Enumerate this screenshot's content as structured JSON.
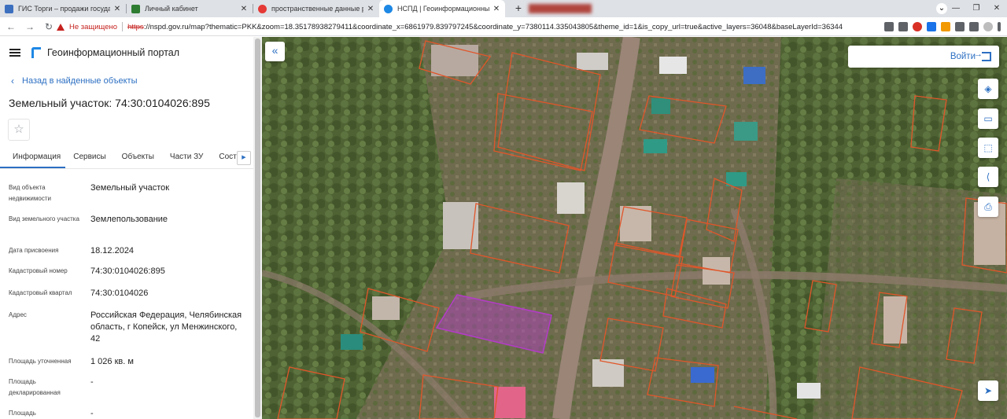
{
  "browser": {
    "tabs": [
      {
        "title": "ГИС Торги – продажи государств",
        "favicon_color": "#3d6fbf"
      },
      {
        "title": "Личный кабинет",
        "favicon_color": "#2e7d32"
      },
      {
        "title": "пространственные данные рос",
        "favicon_color": "#e53935"
      },
      {
        "title": "НСПД | Геоинформационный п",
        "favicon_color": "#1e88e5"
      }
    ],
    "new_tab_icon": "+",
    "address": {
      "security_label": "Не защищено",
      "url_scheme": "https",
      "url_rest": "://nspd.gov.ru/map?thematic=PKK&zoom=18.35178938279411&coordinate_x=6861979.839797245&coordinate_y=7380114.335043805&theme_id=1&is_copy_url=true&active_layers=36048&baseLayerId=36344"
    }
  },
  "header": {
    "portal_title": "Геоинформационный портал"
  },
  "panel": {
    "back_label": "Назад в найденные объекты",
    "title": "Земельный участок: 74:30:0104026:895",
    "tabs": [
      "Информация",
      "Сервисы",
      "Объекты",
      "Части ЗУ",
      "Соста"
    ],
    "properties": [
      {
        "key": "Вид объекта недвижимости",
        "value": "Земельный участок"
      },
      {
        "key": "Вид земельного участка",
        "value": "Землепользование"
      },
      {
        "key": "Дата присвоения",
        "value": "18.12.2024"
      },
      {
        "key": "Кадастровый номер",
        "value": "74:30:0104026:895"
      },
      {
        "key": "Кадастровый квартал",
        "value": "74:30:0104026"
      },
      {
        "key": "Адрес",
        "value": "Российская Федерация, Челябинская область, г Копейск, ул Менжинского, 42"
      },
      {
        "key": "Площадь уточненная",
        "value": "1 026 кв. м"
      },
      {
        "key": "Площадь декларированная",
        "value": "-"
      },
      {
        "key": "Площадь",
        "value": "-"
      }
    ]
  },
  "map": {
    "login_label": "Войти",
    "controls": [
      "layers-icon",
      "ruler-icon",
      "select-area-icon",
      "share-icon",
      "print-icon",
      "locate-icon"
    ],
    "colors": {
      "parcel_outline": "#e0562a",
      "selected_parcel": "#b43cc8",
      "accent": "#2c6fc2"
    }
  }
}
